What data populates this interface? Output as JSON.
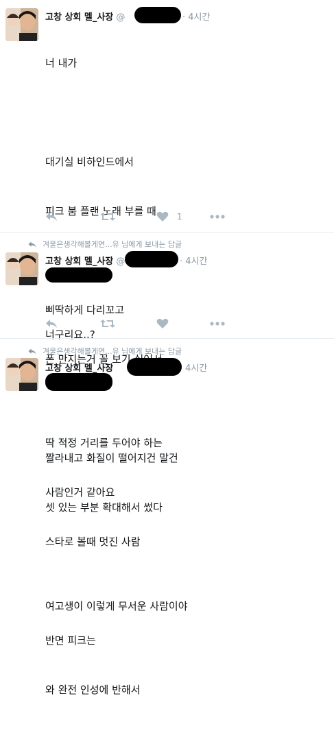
{
  "tweets": [
    {
      "author_name": "고창 상회 멜_사장",
      "handle_prefix": "@",
      "time": "· 4시간",
      "reply_context": "",
      "lines": [
        "너 내가",
        "",
        "대기실 비하인드에서",
        "피크 붐 플랜 노래 부를 때",
        "",
        "삐딱하게 다리꼬고",
        "폰 만지는거 꼴 보기 싫어서",
        "",
        "짤라내고 화질이 떨어지건 말건",
        "셋 있는 부분 확대해서 썼다",
        "",
        "여고생이 이렇게 무서운 사람이야"
      ],
      "like_count": "1"
    },
    {
      "author_name": "고창 상회 멜_사장",
      "handle_prefix": "@",
      "time": "· 4시간",
      "reply_context": "겨울은생각해볼게연...유 님에게 보내는 답글",
      "lines": [
        "너구리요..?"
      ],
      "like_count": ""
    },
    {
      "author_name": "고창 상회 멜_사장",
      "handle_prefix": "",
      "time": "4시간",
      "reply_context": "겨울은생각해볼게연...유 님에게 보내는 답글",
      "lines": [
        "딱 적정 거리를 두어야 하는",
        "사람인거 같아요",
        "스타로 볼때 멋진 사람",
        "",
        "반면 피크는",
        "와 완전 인성에 반해서"
      ],
      "like_count": ""
    }
  ],
  "icons": {
    "reply": "reply-icon",
    "retweet": "retweet-icon",
    "like": "heart-icon",
    "more": "more-icon",
    "reply_context": "reply-arrow-icon"
  },
  "colors": {
    "icon": "#aab8c2",
    "muted": "#8899a6",
    "text": "#14171a",
    "divider": "#e6ecf0"
  }
}
